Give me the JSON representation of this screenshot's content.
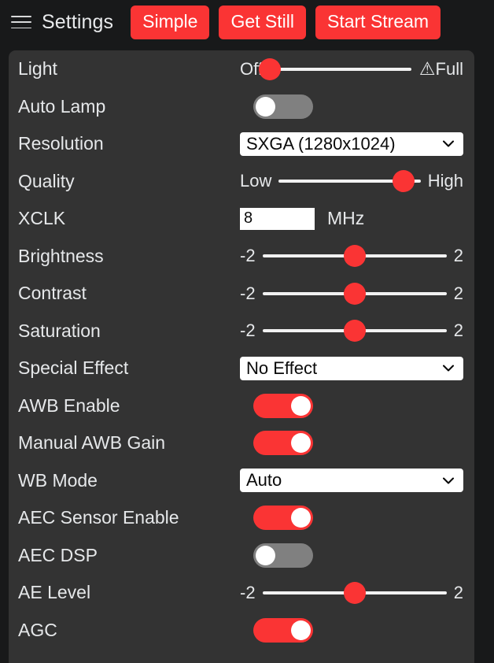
{
  "header": {
    "menu_icon": "hamburger-icon",
    "title": "Settings",
    "buttons": [
      {
        "label": "Simple",
        "name": "simple-button"
      },
      {
        "label": "Get Still",
        "name": "get-still-button"
      },
      {
        "label": "Start Stream",
        "name": "start-stream-button"
      }
    ]
  },
  "colors": {
    "accent": "#fa3434",
    "panel_bg": "#333333",
    "page_bg": "#18191a",
    "text": "#e6e8ea",
    "toggle_off": "#808080",
    "track": "#f2f2f2"
  },
  "settings": {
    "light": {
      "label": "Light",
      "min_label": "Off",
      "max_label": "Full",
      "warn_icon": "warning-triangle-icon",
      "value": 0,
      "min": 0,
      "max": 255,
      "percent": 0
    },
    "auto_lamp": {
      "label": "Auto Lamp",
      "state": "off"
    },
    "resolution": {
      "label": "Resolution",
      "value": "SXGA (1280x1024)",
      "chevron_icon": "chevron-down-icon"
    },
    "quality": {
      "label": "Quality",
      "min_label": "Low",
      "max_label": "High",
      "percent": 88
    },
    "xclk": {
      "label": "XCLK",
      "value": "8",
      "unit": "MHz"
    },
    "brightness": {
      "label": "Brightness",
      "min_label": "-2",
      "max_label": "2",
      "value": 0,
      "percent": 50
    },
    "contrast": {
      "label": "Contrast",
      "min_label": "-2",
      "max_label": "2",
      "value": 0,
      "percent": 50
    },
    "saturation": {
      "label": "Saturation",
      "min_label": "-2",
      "max_label": "2",
      "value": 0,
      "percent": 50
    },
    "special_effect": {
      "label": "Special Effect",
      "value": "No Effect",
      "chevron_icon": "chevron-down-icon"
    },
    "awb_enable": {
      "label": "AWB Enable",
      "state": "on"
    },
    "manual_awb_gain": {
      "label": "Manual AWB Gain",
      "state": "on"
    },
    "wb_mode": {
      "label": "WB Mode",
      "value": "Auto",
      "chevron_icon": "chevron-down-icon"
    },
    "aec_sensor_enable": {
      "label": "AEC Sensor Enable",
      "state": "on"
    },
    "aec_dsp": {
      "label": "AEC DSP",
      "state": "off"
    },
    "ae_level": {
      "label": "AE Level",
      "min_label": "-2",
      "max_label": "2",
      "value": 0,
      "percent": 50
    },
    "agc": {
      "label": "AGC",
      "state": "on"
    }
  }
}
